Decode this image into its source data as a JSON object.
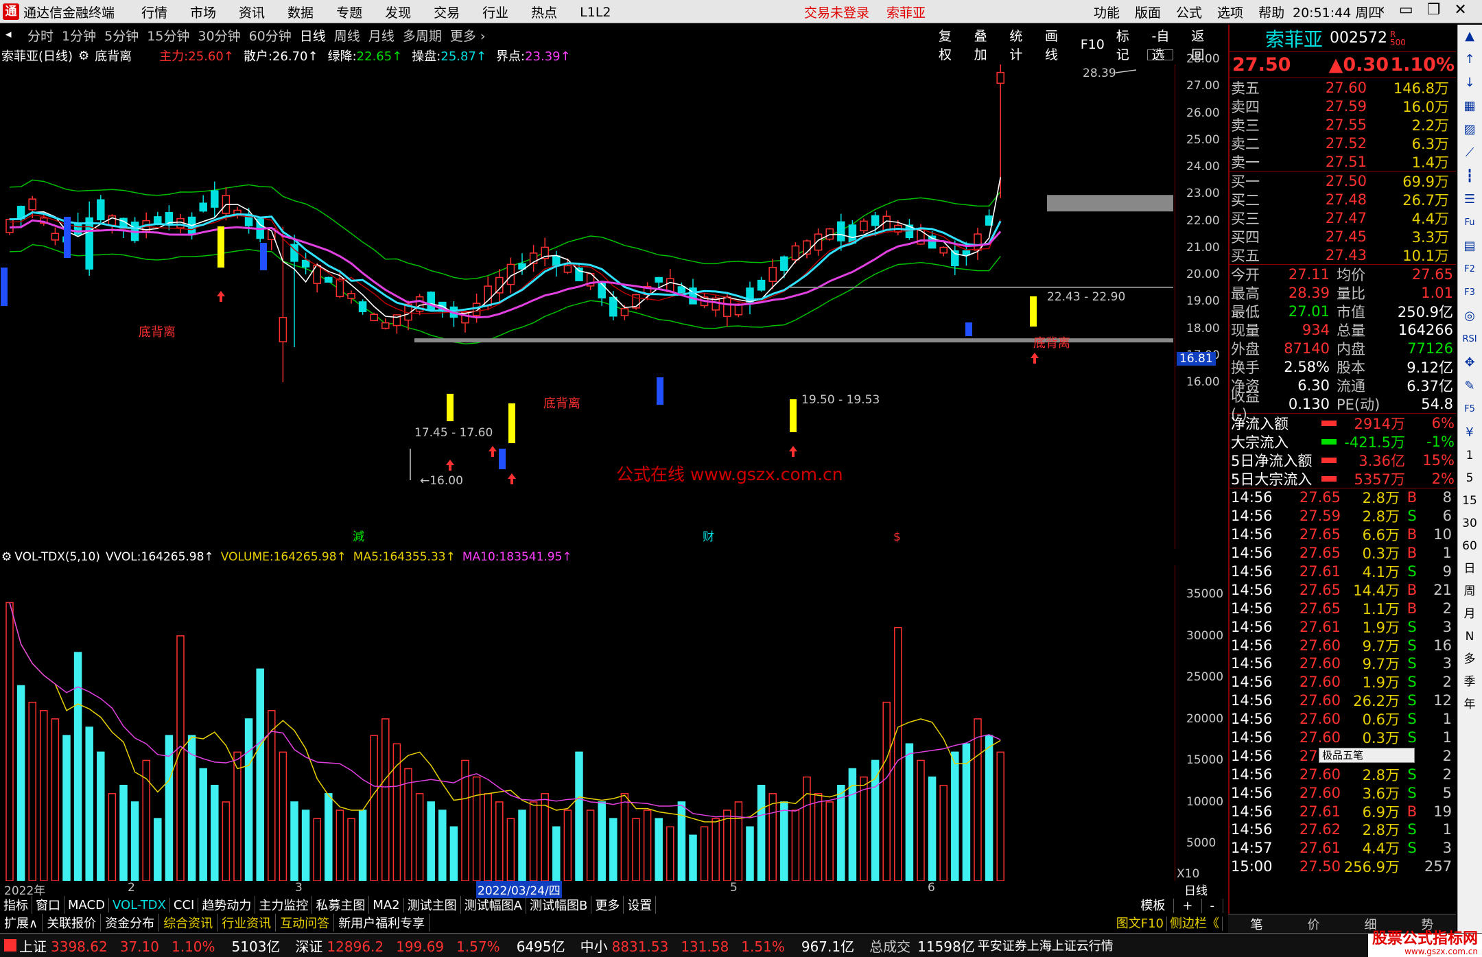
{
  "titlebar": {
    "logo_glyph": "通",
    "app_name": "通达信金融终端",
    "menu": [
      "行情",
      "市场",
      "资讯",
      "数据",
      "专题",
      "发现",
      "交易",
      "行业",
      "热点",
      "L1L2"
    ],
    "login_status": "交易未登录",
    "stock_name": "索菲亚",
    "right_menu": [
      "功能",
      "版面",
      "公式",
      "选项",
      "帮助"
    ],
    "time": "20:51:44",
    "weekday": "周四",
    "win_buttons": [
      "‹",
      "▭",
      "❐",
      "✕"
    ]
  },
  "periodbar": {
    "periods": [
      "分时",
      "1分钟",
      "5分钟",
      "15分钟",
      "30分钟",
      "60分钟",
      "日线",
      "周线",
      "月线",
      "多周期",
      "更多 ›"
    ],
    "active": "日线",
    "tools": [
      "复权",
      "叠加",
      "统计",
      "画线",
      "F10",
      "标记",
      "-自选",
      "返回"
    ]
  },
  "stockinfo": {
    "title": "索菲亚(日线)",
    "indicator": "底背离",
    "items": [
      {
        "label": "主力:",
        "value": "25.60↑",
        "color": "#ff3030"
      },
      {
        "label": "散户:",
        "value": "26.70↑",
        "color": "#ffffff"
      },
      {
        "label": "绿降:",
        "value": "22.65↑",
        "color": "#00e000"
      },
      {
        "label": "操盘:",
        "value": "25.87↑",
        "color": "#00e0e0"
      },
      {
        "label": "界点:",
        "value": "23.39↑",
        "color": "#ff40ff"
      }
    ]
  },
  "chart_labels": {
    "high": "28.39",
    "low": "16.00",
    "price_tag": "16.81",
    "range1": "17.45 - 17.60",
    "range2": "19.50 - 19.53",
    "range3": "22.43 - 22.90",
    "bottom_div": "底背离",
    "watermark": "公式在线  www.gszx.com.cn",
    "markers": [
      "減",
      "财",
      "$"
    ]
  },
  "y_axis_price": [
    "28.00",
    "27.00",
    "26.00",
    "25.00",
    "24.00",
    "23.00",
    "22.00",
    "21.00",
    "20.00",
    "19.00",
    "18.00",
    "17.00",
    "16.00"
  ],
  "volume": {
    "head": "VOL-TDX(5,10)",
    "items": [
      {
        "label": "VVOL:",
        "value": "164265.98↑",
        "color": "#ffffff"
      },
      {
        "label": "VOLUME:",
        "value": "164265.98↑",
        "color": "#e8d000"
      },
      {
        "label": "MA5:",
        "value": "164355.33↑",
        "color": "#e8d000"
      },
      {
        "label": "MA10:",
        "value": "183541.95↑",
        "color": "#ff40ff"
      }
    ],
    "y_axis": [
      "35000",
      "30000",
      "25000",
      "20000",
      "15000",
      "10000",
      "5000"
    ],
    "unit": "X10"
  },
  "dateaxis": {
    "labels": [
      "2022年",
      "2",
      "3",
      "2022/03/24/四",
      "5",
      "6"
    ],
    "period": "日线"
  },
  "tabs1": [
    "指标",
    "窗口",
    "MACD",
    "VOL-TDX",
    "CCI",
    "趋势动力",
    "主力监控",
    "私募主图",
    "MA2",
    "测试主图",
    "测试幅图A",
    "测试幅图B",
    "更多",
    "设置"
  ],
  "tabs1_right": [
    "模板",
    "+",
    "-"
  ],
  "tabs2": [
    "扩展∧",
    "关联报价",
    "资金分布",
    "综合资讯",
    "行业资讯",
    "互动问答",
    "新用户福利专享"
  ],
  "tabs2_right": [
    "图文F10",
    "侧边栏《"
  ],
  "rp_bottom_tabs": [
    "笔",
    "价",
    "细",
    "势"
  ],
  "right": {
    "name": "索菲亚",
    "code": "002572",
    "price": "27.50",
    "change": "▲0.30",
    "pct": "1.10%",
    "sells": [
      {
        "label": "卖五",
        "price": "27.60",
        "vol": "146.8万"
      },
      {
        "label": "卖四",
        "price": "27.59",
        "vol": "16.0万"
      },
      {
        "label": "卖三",
        "price": "27.55",
        "vol": "2.2万"
      },
      {
        "label": "卖二",
        "price": "27.52",
        "vol": "6.3万"
      },
      {
        "label": "卖一",
        "price": "27.51",
        "vol": "1.4万"
      }
    ],
    "buys": [
      {
        "label": "买一",
        "price": "27.50",
        "vol": "69.9万"
      },
      {
        "label": "买二",
        "price": "27.48",
        "vol": "26.7万"
      },
      {
        "label": "买三",
        "price": "27.47",
        "vol": "4.4万"
      },
      {
        "label": "买四",
        "price": "27.45",
        "vol": "3.3万"
      },
      {
        "label": "买五",
        "price": "27.43",
        "vol": "10.1万"
      }
    ],
    "stats": [
      {
        "l1": "今开",
        "v1": "27.11",
        "c1": "#ff3030",
        "l2": "均价",
        "v2": "27.65",
        "c2": "#ff3030"
      },
      {
        "l1": "最高",
        "v1": "28.39",
        "c1": "#ff3030",
        "l2": "量比",
        "v2": "1.01",
        "c2": "#ff3030"
      },
      {
        "l1": "最低",
        "v1": "27.01",
        "c1": "#00e000",
        "l2": "市值",
        "v2": "250.9亿",
        "c2": "#ffffff"
      },
      {
        "l1": "现量",
        "v1": "934",
        "c1": "#ff3030",
        "l2": "总量",
        "v2": "164266",
        "c2": "#ffffff"
      },
      {
        "l1": "外盘",
        "v1": "87140",
        "c1": "#ff3030",
        "l2": "内盘",
        "v2": "77126",
        "c2": "#00e000"
      },
      {
        "l1": "换手",
        "v1": "2.58%",
        "c1": "#ffffff",
        "l2": "股本",
        "v2": "9.12亿",
        "c2": "#ffffff"
      },
      {
        "l1": "净资",
        "v1": "6.30",
        "c1": "#ffffff",
        "l2": "流通",
        "v2": "6.37亿",
        "c2": "#ffffff"
      },
      {
        "l1": "收益(-)",
        "v1": "0.130",
        "c1": "#ffffff",
        "l2": "PE(动)",
        "v2": "54.8",
        "c2": "#ffffff"
      }
    ],
    "flows": [
      {
        "label": "净流入额",
        "value": "2914万",
        "pct": "6%",
        "color": "#ff3030"
      },
      {
        "label": "大宗流入",
        "value": "-421.5万",
        "pct": "-1%",
        "color": "#00e000"
      },
      {
        "label": "5日净流入额",
        "value": "3.36亿",
        "pct": "15%",
        "color": "#ff3030"
      },
      {
        "label": "5日大宗流入",
        "value": "5357万",
        "pct": "2%",
        "color": "#ff3030"
      }
    ],
    "ticks": [
      {
        "t": "14:56",
        "p": "27.65",
        "v": "2.8万",
        "bs": "B",
        "n": "8"
      },
      {
        "t": "14:56",
        "p": "27.59",
        "v": "2.8万",
        "bs": "S",
        "n": "6"
      },
      {
        "t": "14:56",
        "p": "27.65",
        "v": "6.6万",
        "bs": "B",
        "n": "10"
      },
      {
        "t": "14:56",
        "p": "27.65",
        "v": "0.3万",
        "bs": "B",
        "n": "1"
      },
      {
        "t": "14:56",
        "p": "27.61",
        "v": "4.1万",
        "bs": "S",
        "n": "9"
      },
      {
        "t": "14:56",
        "p": "27.65",
        "v": "14.4万",
        "bs": "B",
        "n": "21"
      },
      {
        "t": "14:56",
        "p": "27.65",
        "v": "1.1万",
        "bs": "B",
        "n": "2"
      },
      {
        "t": "14:56",
        "p": "27.61",
        "v": "1.9万",
        "bs": "S",
        "n": "3"
      },
      {
        "t": "14:56",
        "p": "27.60",
        "v": "9.7万",
        "bs": "S",
        "n": "16"
      },
      {
        "t": "14:56",
        "p": "27.60",
        "v": "9.7万",
        "bs": "S",
        "n": "3"
      },
      {
        "t": "14:56",
        "p": "27.60",
        "v": "1.9万",
        "bs": "S",
        "n": "2"
      },
      {
        "t": "14:56",
        "p": "27.60",
        "v": "26.2万",
        "bs": "S",
        "n": "12"
      },
      {
        "t": "14:56",
        "p": "27.60",
        "v": "0.6万",
        "bs": "S",
        "n": "1"
      },
      {
        "t": "14:56",
        "p": "27.60",
        "v": "0.3万",
        "bs": "S",
        "n": "1"
      },
      {
        "t": "14:56",
        "p": "27.60",
        "v": "",
        "bs": "",
        "n": "2"
      },
      {
        "t": "14:56",
        "p": "27.60",
        "v": "2.8万",
        "bs": "S",
        "n": "2"
      },
      {
        "t": "14:56",
        "p": "27.60",
        "v": "3.6万",
        "bs": "S",
        "n": "5"
      },
      {
        "t": "14:56",
        "p": "27.61",
        "v": "6.9万",
        "bs": "B",
        "n": "19"
      },
      {
        "t": "14:56",
        "p": "27.62",
        "v": "2.8万",
        "bs": "S",
        "n": "1"
      },
      {
        "t": "14:57",
        "p": "27.61",
        "v": "4.4万",
        "bs": "S",
        "n": "3"
      },
      {
        "t": "15:00",
        "p": "27.50",
        "v": "256.9万",
        "bs": "",
        "n": "257"
      }
    ],
    "ime_popup": "极品五笔"
  },
  "sidebar_icons": [
    "tri-up-icon",
    "arrow-up-icon",
    "arrow-down-icon",
    "grid-icon",
    "chart-icon",
    "line-chart-icon",
    "candle-icon",
    "list-icon",
    "fund-icon",
    "table-icon",
    "f2-icon",
    "f3-icon",
    "circle-icon",
    "rsi-icon",
    "move-icon",
    "pen-icon",
    "f5-icon",
    "money-icon"
  ],
  "sidebar_labels": [
    "1",
    "5",
    "15",
    "30",
    "60",
    "日",
    "周",
    "月",
    "N",
    "多",
    "季",
    "年"
  ],
  "statusbar": {
    "items": [
      {
        "name": "上证",
        "v": "3398.62",
        "c": "37.10",
        "p": "1.10%",
        "amt": "5103亿"
      },
      {
        "name": "深证",
        "v": "12896.2",
        "c": "199.69",
        "p": "1.57%",
        "amt": "6495亿"
      },
      {
        "name": "中小",
        "v": "8831.53",
        "c": "131.58",
        "p": "1.51%",
        "amt": "967.1亿"
      }
    ],
    "total_label": "总成交",
    "total": "11598亿",
    "broker": "平安证券上海上证云行情",
    "brand": "股票公式指标网",
    "brand_url": "www.gszx.com.cn"
  },
  "colors": {
    "up": "#ff3030",
    "down": "#00e0e0",
    "ma_white": "#ffffff",
    "ma_cyan": "#30e0ff",
    "ma_magenta": "#e040e0",
    "boll": "#00c000",
    "vol_ma5": "#e8d000"
  }
}
